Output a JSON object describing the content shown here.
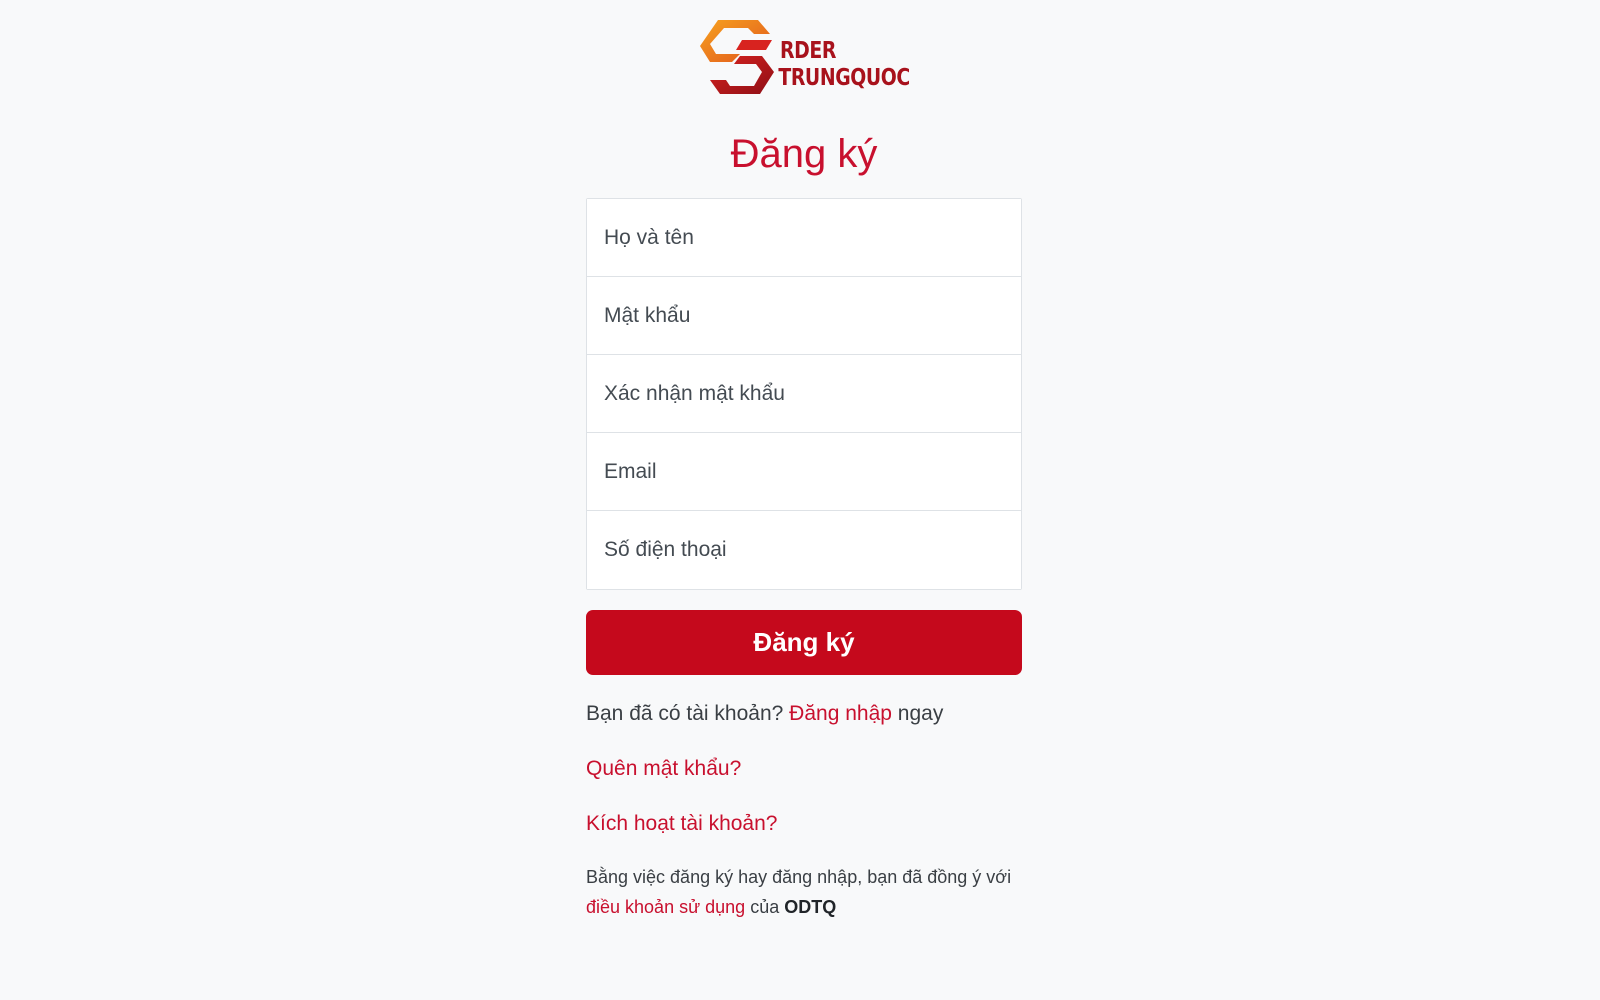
{
  "logo": {
    "line1": "RDER",
    "line2": "TRUNGQUOC"
  },
  "page_title": "Đăng ký",
  "form": {
    "fullname_placeholder": "Họ và tên",
    "password_placeholder": "Mật khẩu",
    "confirm_password_placeholder": "Xác nhận mật khẩu",
    "email_placeholder": "Email",
    "phone_placeholder": "Số điện thoại"
  },
  "submit_label": "Đăng ký",
  "login_prompt": {
    "prefix": "Bạn đã có tài khoản?",
    "link": "Đăng nhập",
    "suffix": "ngay"
  },
  "forgot_password_link": "Quên mật khẩu?",
  "activate_account_link": "Kích hoạt tài khoản?",
  "terms": {
    "prefix": "Bằng việc đăng ký hay đăng nhập, bạn đã đồng ý với",
    "link": "điều khoản sử dụng",
    "middle": "của",
    "brand": "ODTQ"
  },
  "colors": {
    "accent": "#c8102e",
    "button": "#c5091c",
    "background": "#f8f9fa",
    "logo_orange": "#f08a1c",
    "logo_red": "#a8121c"
  }
}
